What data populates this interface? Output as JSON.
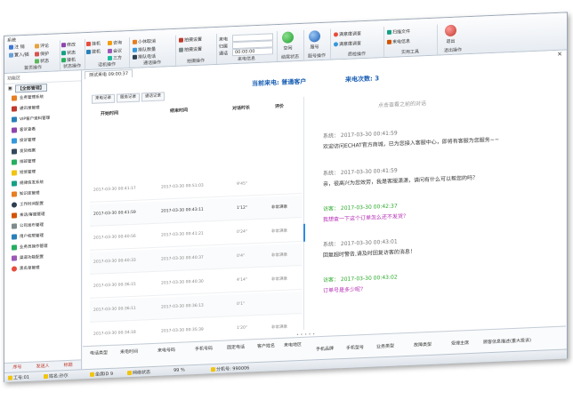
{
  "ribbon": {
    "tab_label": "系统",
    "groups": [
      {
        "caption": "首页操作",
        "items": [
          "注 销",
          "置入/插",
          "评论",
          "保护",
          "状态"
        ]
      },
      {
        "caption": "状态操作",
        "items": [
          "修改",
          "状态",
          "接机"
        ]
      },
      {
        "caption": "话机操作",
        "items": [
          "挂机",
          "拨机",
          "咨询",
          "会议",
          "三方"
        ]
      },
      {
        "caption": "通话操作",
        "items": [
          "小休取消",
          "排队数量",
          "排队电话"
        ]
      },
      {
        "caption": "拍摄操作",
        "items": [
          "拍摄设置",
          "拍摄设置"
        ]
      },
      {
        "caption": "来电信息",
        "items": [
          "来电",
          "归属",
          "通话"
        ]
      },
      {
        "caption": "结尾状态",
        "items": [
          "空闲"
        ]
      },
      {
        "caption": "服号操作",
        "items": [
          "服号"
        ]
      },
      {
        "caption": "质检操作",
        "items": [
          "满意度调查",
          "满意度调查"
        ]
      },
      {
        "caption": "实用工具",
        "items": [
          "扫描文件",
          "来电信息"
        ]
      },
      {
        "caption": "退出操作",
        "items": [
          "退出"
        ]
      }
    ],
    "call_time": "00:00:00"
  },
  "nav": {
    "header": "功能区",
    "root_label": "【全部管理】",
    "items": [
      "业务管理系统",
      "通讯录管理",
      "VIP客户资料管理",
      "客诉查看",
      "投诉管理",
      "发货档案",
      "排班管理",
      "短信管理",
      "规律信发系统",
      "知识库管理",
      "工作时间配置",
      "来话/客服管理",
      "公司发布管理",
      "用户权限管理",
      "业务员操作管理",
      "渠道功能配置",
      "黑名单管理"
    ],
    "tabs": [
      "序号",
      "发送人",
      "标题"
    ]
  },
  "main": {
    "doc_tab": "测试来电 09:00:37",
    "caller_type": "当前来电: 普通客户",
    "call_count": "来电次数: 3",
    "sub_tabs": [
      "来电记录",
      "服务记录",
      "通话记录"
    ],
    "columns": [
      "开始时间",
      "结束时间",
      "对话时长",
      "评价"
    ],
    "rows": [
      {
        "start": "2017-03-30 00:41:17",
        "end": "2017-03-30 00:51:03",
        "dur": "9'45\"",
        "rate": ""
      },
      {
        "start": "2017-03-30 00:41:59",
        "end": "2017-03-30 00:43:11",
        "dur": "1'12\"",
        "rate": "非常满意"
      },
      {
        "start": "2017-03-30 00:40:56",
        "end": "2017-03-30 00:41:21",
        "dur": "0'24\"",
        "rate": "非常满意"
      },
      {
        "start": "2017-03-30 00:40:33",
        "end": "2017-03-30 00:40:37",
        "dur": "0'4\"",
        "rate": "非常满意"
      },
      {
        "start": "2017-03-30 00:36:15",
        "end": "2017-03-30 00:40:30",
        "dur": "4'14\"",
        "rate": "非常满意"
      },
      {
        "start": "2017-03-30 00:36:11",
        "end": "2017-03-30 00:36:13",
        "dur": "0'1\"",
        "rate": ""
      },
      {
        "start": "2017-03-30 00:34:18",
        "end": "2017-03-30 00:35:39",
        "dur": "1'20\"",
        "rate": "非常满意"
      }
    ],
    "chat_title": "点击查看之前的对话",
    "messages": [
      {
        "who": "系统：  2017-03-30 00:41:59",
        "text": "欢迎访问ECHAT官方商城，已为您接入客服中心，即将有客服为您服务~~",
        "kind": "sys"
      },
      {
        "who": "系统：  2017-03-30 00:41:59",
        "text": "亲，很高兴为您效劳，我是客服潇潇，请问有什么可以帮您的吗？",
        "kind": "sys"
      },
      {
        "who": "访客：  2017-03-30 00:42:37",
        "text": "我想查一下这个订单怎么还不发货？",
        "kind": "vis"
      },
      {
        "who": "系统：  2017-03-30 00:43:01",
        "text": "回复超时警告,请及时回复访客的消息！",
        "kind": "sys"
      },
      {
        "who": "访客：  2017-03-30 00:43:02",
        "text": "订单号是多少呢？",
        "kind": "vis"
      }
    ],
    "bottom_headers_row1": [
      "电话类型",
      "来电时间",
      "来电号码",
      "手机号码",
      "固定电话",
      "客户姓名",
      "来电地区"
    ],
    "bottom_headers_row2": [
      "手机品牌",
      "手机型号",
      "业务类型",
      "故障类型",
      "受理主席",
      "顾客信息描述(重大投诉)"
    ]
  },
  "status": {
    "items": [
      "工号:01",
      "姓名:孙尔",
      "坐席ID 9",
      "网络状态",
      "99 %",
      "分机号: 990006"
    ]
  },
  "colors": {
    "accent": "#1a5fb4",
    "visitor": "#2eaa2e",
    "visitor_text": "#b32ab3"
  }
}
